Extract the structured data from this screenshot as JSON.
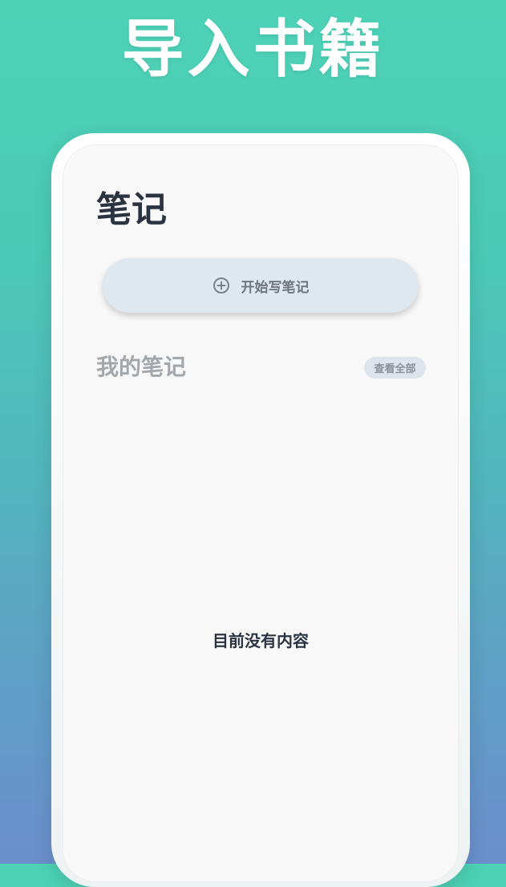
{
  "banner": {
    "title": "导入书籍"
  },
  "notes_screen": {
    "title": "笔记",
    "write_button": {
      "icon": "plus-circle-icon",
      "label": "开始写笔记"
    },
    "my_notes": {
      "title": "我的笔记",
      "view_all_label": "查看全部"
    },
    "empty_state": "目前没有内容"
  },
  "colors": {
    "title_text": "#2b3340",
    "button_bg": "#dfe7ef",
    "muted_text": "#a3a7ab",
    "screen_bg": "#f8f8f8"
  }
}
